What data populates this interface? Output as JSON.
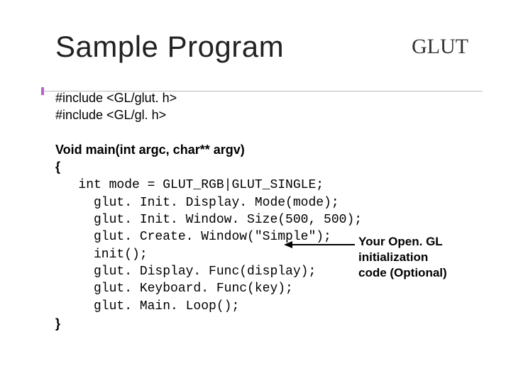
{
  "title": "Sample Program",
  "corner_label": "GLUT",
  "includes": [
    "#include <GL/glut. h>",
    "#include <GL/gl. h>"
  ],
  "main_signature": "Void main(int argc, char** argv)",
  "open_brace": "{",
  "code_lines": [
    "   int mode = GLUT_RGB|GLUT_SINGLE;",
    "     glut. Init. Display. Mode(mode);",
    "     glut. Init. Window. Size(500, 500);",
    "     glut. Create. Window(\"Simple\");",
    "     init();",
    "     glut. Display. Func(display);",
    "     glut. Keyboard. Func(key);",
    "     glut. Main. Loop();"
  ],
  "close_brace": "}",
  "annotation_line1": "Your Open. GL initialization",
  "annotation_line2": "code (Optional)"
}
